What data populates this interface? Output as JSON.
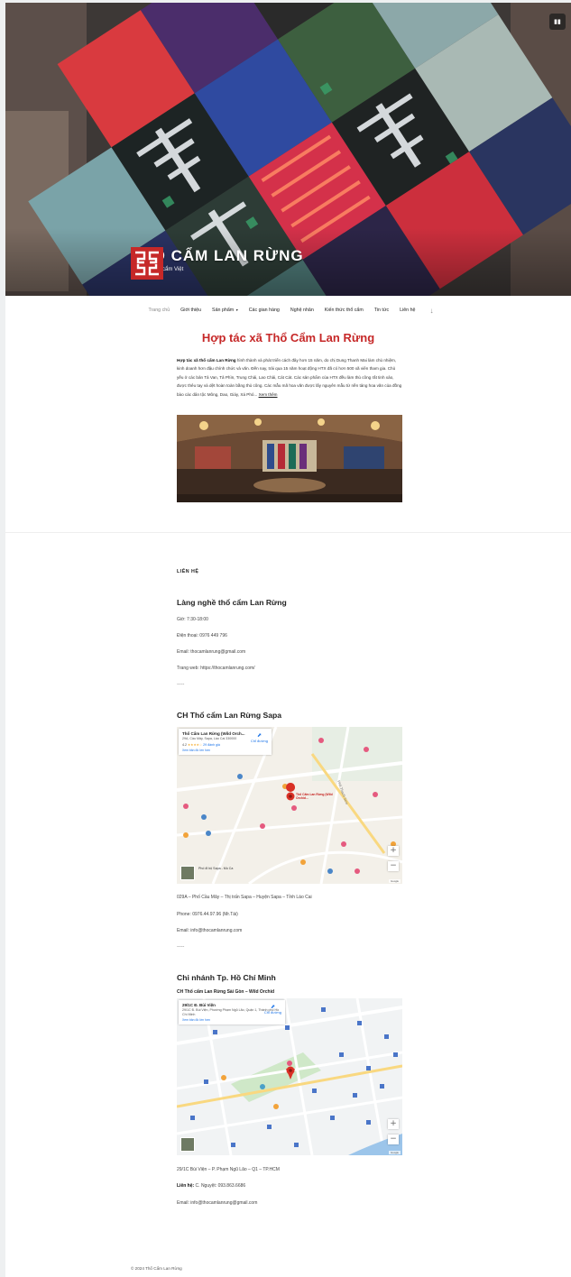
{
  "header": {
    "site_title": "THỔ CẨM LAN RỪNG",
    "site_description": "Làm nên thổ cẩm Việt",
    "menu_icon": "menu-icon"
  },
  "nav": {
    "items": [
      {
        "label": "Trang chủ"
      },
      {
        "label": "Giới thiệu"
      },
      {
        "label": "Sản phẩm"
      },
      {
        "label": "Các gian hàng"
      },
      {
        "label": "Nghệ nhân"
      },
      {
        "label": "Kiến thức thổ cẩm"
      },
      {
        "label": "Tin tức"
      },
      {
        "label": "Liên hệ"
      }
    ],
    "dropdown_icon": "chevron-down-icon",
    "scroll_icon": "arrow-down-icon"
  },
  "intro": {
    "title": "Hợp tác xã Thổ Cẩm Lan Rừng",
    "lead_bold": "Hợp tác xã thổ cẩm Lan Rừng",
    "body": " hình thành và phát triển cách đây hơn 15 năm, do chị Dung Thanh Mai làm chủ nhiệm, kinh doanh hơn đậu chính chức và văn. Đến nay, trải qua 15 năm hoạt động HTX đã có hơn 500 xã viên tham gia. Chủ yếu ở các bản Tả Van, Tả Phìn, Trung Chải, Lao Chải, Cát Cát. Các sản phẩm của HTX đều làm thủ công rất tinh xảo, được thêu tay và dệt hoàn toàn bằng thủ công. Các mẫu mã hoa văn được lấy nguyên mẫu từ nền tảng hoa văn của đồng bào các dân tộc Mông, Dao, Giáy, Xá Phó...",
    "more": "Xem thêm"
  },
  "contact": {
    "label": "LIÊN HỆ",
    "village": {
      "title": "Làng nghề thổ cẩm Lan Rừng",
      "hours": "Giờ: 7:30-18:00",
      "phone": "Điện thoại: 0976 449 796",
      "email": "Email: thocamlanrung@gmail.com",
      "web": "Trang web: https://thocamlanrung.com/",
      "sep": "-----"
    },
    "sapa": {
      "title": "CH Thổ cẩm Lan Rừng Sapa",
      "map_card_title": "Thổ Cẩm Lan Rừng (Wild Orch...",
      "map_card_addr": "29A, Cầu Mây, Sapa, Lào Cai 330000",
      "map_card_rating": "4.2",
      "map_card_stars": "★★★★☆",
      "map_card_reviews": "29 đánh giá",
      "map_card_link": "Xem bản đồ lớn hơn",
      "map_card_dir": "Chỉ đường",
      "map_pin_label": "Thổ Cẩm Lan Rừng (Wild Orchid...",
      "thumb_label": "Phố đi bộ Sapa - Mù Ca",
      "address": "029A – Phố Cầu Mây – Thị trấn Sapa – Huyện Sapa – Tỉnh Lào Cai",
      "phone": "Phone: 0976.44.97.96 (Mr.Tài)",
      "email": "Email: info@thocamlanrung.com",
      "sep": "-----"
    },
    "hcm": {
      "title": "Chi nhánh Tp. Hồ Chí Minh",
      "subtitle": "CH Thổ cẩm Lan Rừng Sài Gòn – Wild Orchid",
      "map_card_title": "29/1C Đ. Bùi Viện",
      "map_card_addr": "29/1C Đ. Bùi Viện, Phường Phạm Ngũ Lão, Quận 1, Thành phố Hồ Chí Minh",
      "map_card_link": "Xem bản đồ lớn hơn",
      "map_card_dir": "Chỉ đường",
      "address": "29/1C Bùi Viện – P. Phạm Ngũ Lão – Q1 – TP.HCM",
      "contact_label": "Liên hệ:",
      "contact_value": " C. Nguyệt: 093.863.6686",
      "email": "Email: info@thocamlanrung@gmail.com"
    }
  },
  "footer": {
    "copyright": "© 2024 Thổ Cẩm Lan Rừng"
  },
  "colors": {
    "accent_red": "#c62828",
    "text": "#222222",
    "map_road": "#ffffff",
    "map_land": "#f3f0e9"
  }
}
